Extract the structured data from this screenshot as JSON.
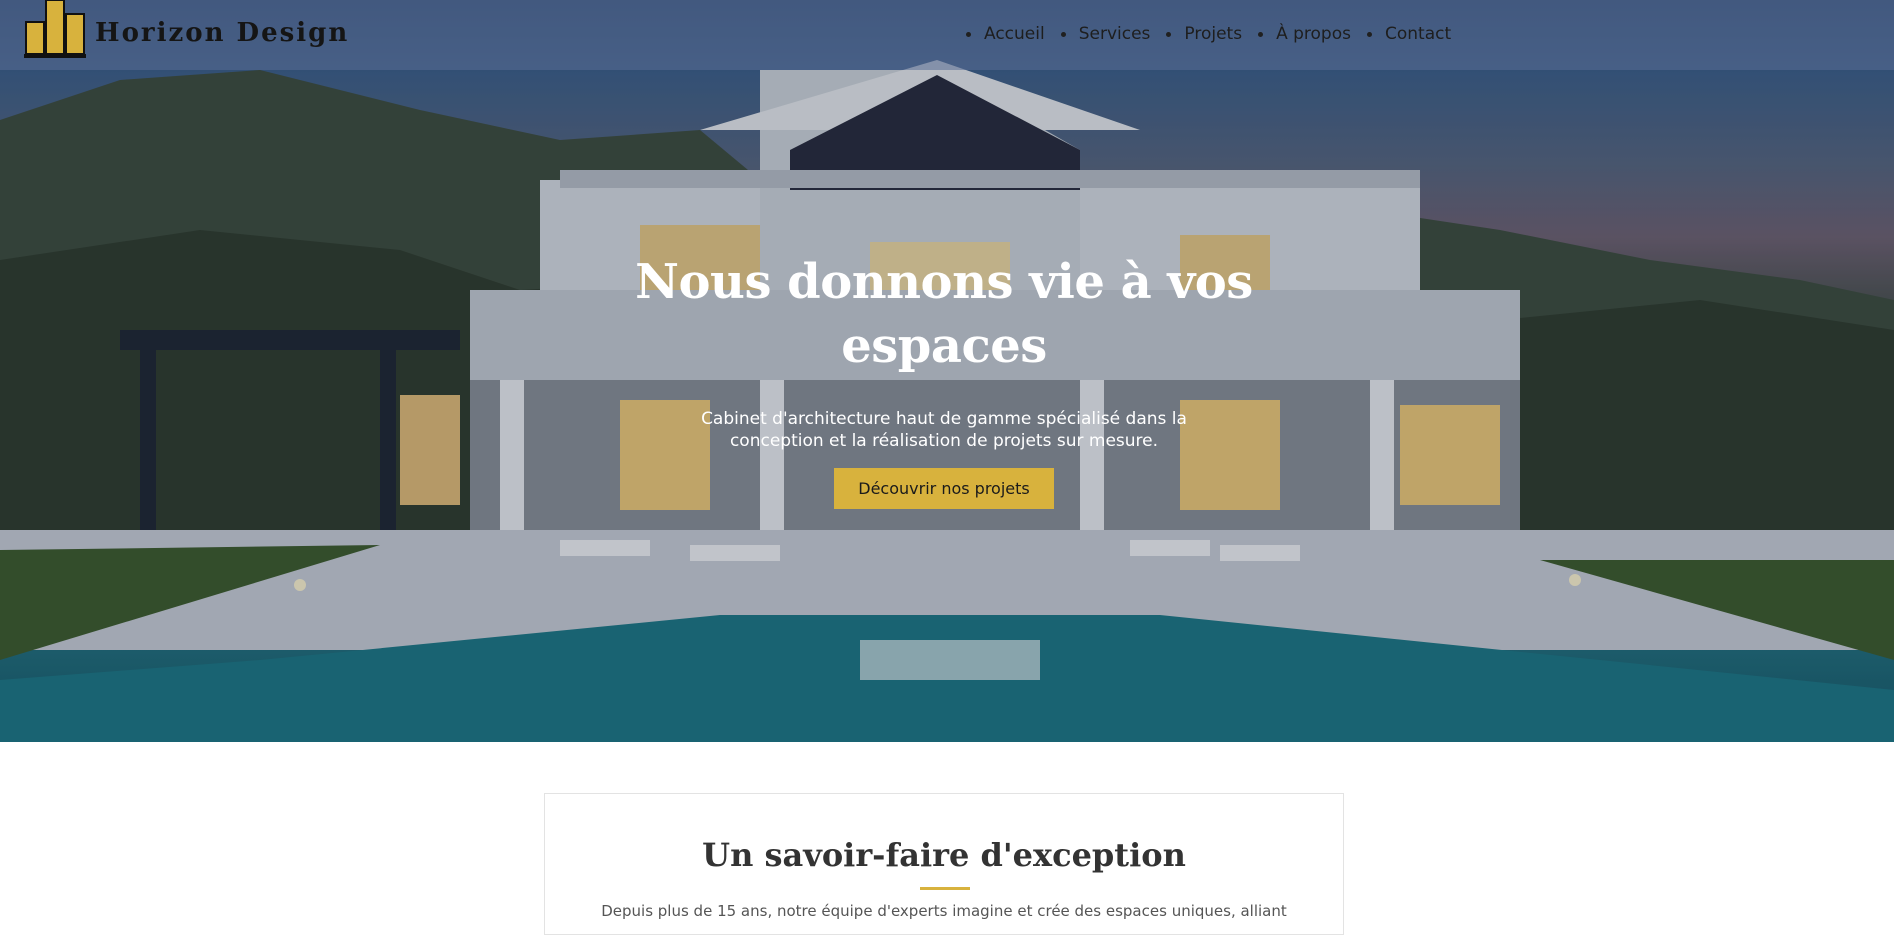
{
  "header": {
    "brand": "Horizon Design",
    "nav": [
      "Accueil",
      "Services",
      "Projets",
      "À propos",
      "Contact"
    ]
  },
  "hero": {
    "title": "Nous donnons vie à vos espaces",
    "subtitle": "Cabinet d'architecture haut de gamme spécialisé dans la conception et la réalisation de projets sur mesure.",
    "cta": "Découvrir nos projets"
  },
  "about": {
    "title": "Un savoir-faire d'exception",
    "text": "Depuis plus de 15 ans, notre équipe d'experts imagine et crée des espaces uniques, alliant"
  },
  "icons": {
    "logo": "building-logo-icon",
    "nav_bullet": "bullet-dot-icon"
  },
  "colors": {
    "accent": "#d8b23d",
    "header_bg": "#5a6e96",
    "hero_text": "#ffffff",
    "body_text": "#555555"
  }
}
